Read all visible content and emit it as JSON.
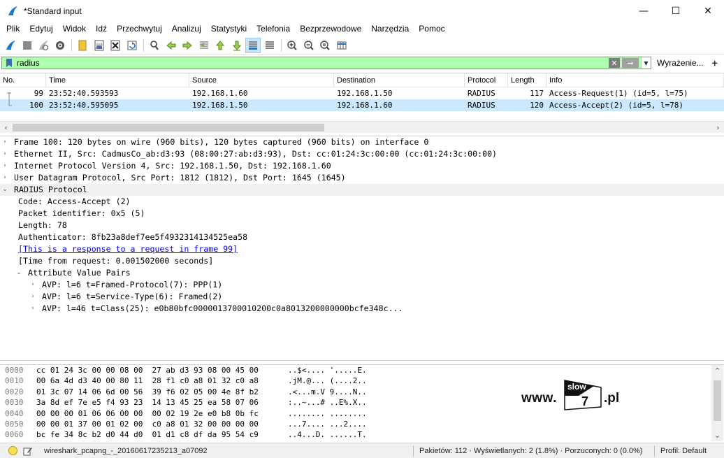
{
  "window": {
    "title": "*Standard input",
    "minimize": "—",
    "maximize": "☐",
    "close": "✕"
  },
  "menu": [
    "Plik",
    "Edytuj",
    "Widok",
    "Idź",
    "Przechwytuj",
    "Analizuj",
    "Statystyki",
    "Telefonia",
    "Bezprzewodowe",
    "Narzędzia",
    "Pomoc"
  ],
  "filter": {
    "value": "radius",
    "expression_label": "Wyrażenie...",
    "plus": "+"
  },
  "packet_list": {
    "columns": [
      "No.",
      "Time",
      "Source",
      "Destination",
      "Protocol",
      "Length",
      "Info"
    ],
    "rows": [
      {
        "no": "99",
        "time": "23:52:40.593593",
        "source": "192.168.1.60",
        "destination": "192.168.1.50",
        "protocol": "RADIUS",
        "length": "117",
        "info": "Access-Request(1) (id=5, l=75)"
      },
      {
        "no": "100",
        "time": "23:52:40.595095",
        "source": "192.168.1.50",
        "destination": "192.168.1.60",
        "protocol": "RADIUS",
        "length": "120",
        "info": "Access-Accept(2) (id=5, l=78)"
      }
    ]
  },
  "details": [
    {
      "text": "Frame 100: 120 bytes on wire (960 bits), 120 bytes captured (960 bits) on interface 0",
      "indent": 0,
      "arrow": "›"
    },
    {
      "text": "Ethernet II, Src: CadmusCo_ab:d3:93 (08:00:27:ab:d3:93), Dst: cc:01:24:3c:00:00 (cc:01:24:3c:00:00)",
      "indent": 0,
      "arrow": "›"
    },
    {
      "text": "Internet Protocol Version 4, Src: 192.168.1.50, Dst: 192.168.1.60",
      "indent": 0,
      "arrow": "›"
    },
    {
      "text": "User Datagram Protocol, Src Port: 1812 (1812), Dst Port: 1645 (1645)",
      "indent": 0,
      "arrow": "›"
    },
    {
      "text": "RADIUS Protocol",
      "indent": 0,
      "arrow": "⌄"
    },
    {
      "text": "Code: Access-Accept (2)",
      "indent": 1,
      "arrow": ""
    },
    {
      "text": "Packet identifier: 0x5 (5)",
      "indent": 1,
      "arrow": ""
    },
    {
      "text": "Length: 78",
      "indent": 1,
      "arrow": ""
    },
    {
      "text": "Authenticator: 8fb23a8def7ee5f4932314134525ea58",
      "indent": 1,
      "arrow": ""
    },
    {
      "text": "[This is a response to a request in frame 99]",
      "indent": 1,
      "arrow": "",
      "link": true
    },
    {
      "text": "[Time from request: 0.001502000 seconds]",
      "indent": 1,
      "arrow": ""
    },
    {
      "text": "Attribute Value Pairs",
      "indent": 1,
      "arrow": "⌄"
    },
    {
      "text": "AVP: l=6 t=Framed-Protocol(7): PPP(1)",
      "indent": 2,
      "arrow": "›"
    },
    {
      "text": "AVP: l=6 t=Service-Type(6): Framed(2)",
      "indent": 2,
      "arrow": "›"
    },
    {
      "text": "AVP: l=46 t=Class(25): e0b80bfc0000013700010200c0a8013200000000bcfe348c...",
      "indent": 2,
      "arrow": "›"
    }
  ],
  "hex": [
    {
      "off": "0000",
      "bytes": "cc 01 24 3c 00 00 08 00  27 ab d3 93 08 00 45 00",
      "ascii": "..$<.... '.....E."
    },
    {
      "off": "0010",
      "bytes": "00 6a 4d d3 40 00 80 11  28 f1 c0 a8 01 32 c0 a8",
      "ascii": ".jM.@... (....2.."
    },
    {
      "off": "0020",
      "bytes": "01 3c 07 14 06 6d 00 56  39 f6 02 05 00 4e 8f b2",
      "ascii": ".<...m.V 9....N.."
    },
    {
      "off": "0030",
      "bytes": "3a 8d ef 7e e5 f4 93 23  14 13 45 25 ea 58 07 06",
      "ascii": ":..~...# ..E%.X.."
    },
    {
      "off": "0040",
      "bytes": "00 00 00 01 06 06 00 00  00 02 19 2e e0 b8 0b fc",
      "ascii": "........ ........"
    },
    {
      "off": "0050",
      "bytes": "00 00 01 37 00 01 02 00  c0 a8 01 32 00 00 00 00",
      "ascii": "...7.... ...2...."
    },
    {
      "off": "0060",
      "bytes": "bc fe 34 8c b2 d0 44 d0  01 d1 c8 df da 95 54 c9",
      "ascii": "..4...D. ......T."
    }
  ],
  "logo": {
    "www": "www.",
    "badge_top": "slow",
    "badge_num": "7",
    "pl": ".pl"
  },
  "status": {
    "file": "wireshark_pcapng_-_20160617235213_a07092",
    "stats": "Pakietów: 112 · Wyświetlanych: 2 (1.8%) · Porzuconych: 0 (0.0%)",
    "profile": "Profil: Default"
  }
}
